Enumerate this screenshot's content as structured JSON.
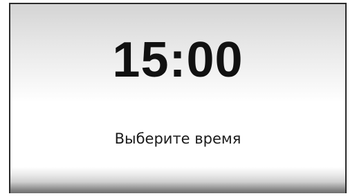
{
  "display": {
    "time": "15:00",
    "hint": "Выберите время"
  },
  "colors": {
    "frame": "#2a2a2a",
    "text": "#111111",
    "background_top": "#d4d4d4",
    "background_mid": "#ffffff",
    "background_bottom": "#6e6e6e"
  }
}
